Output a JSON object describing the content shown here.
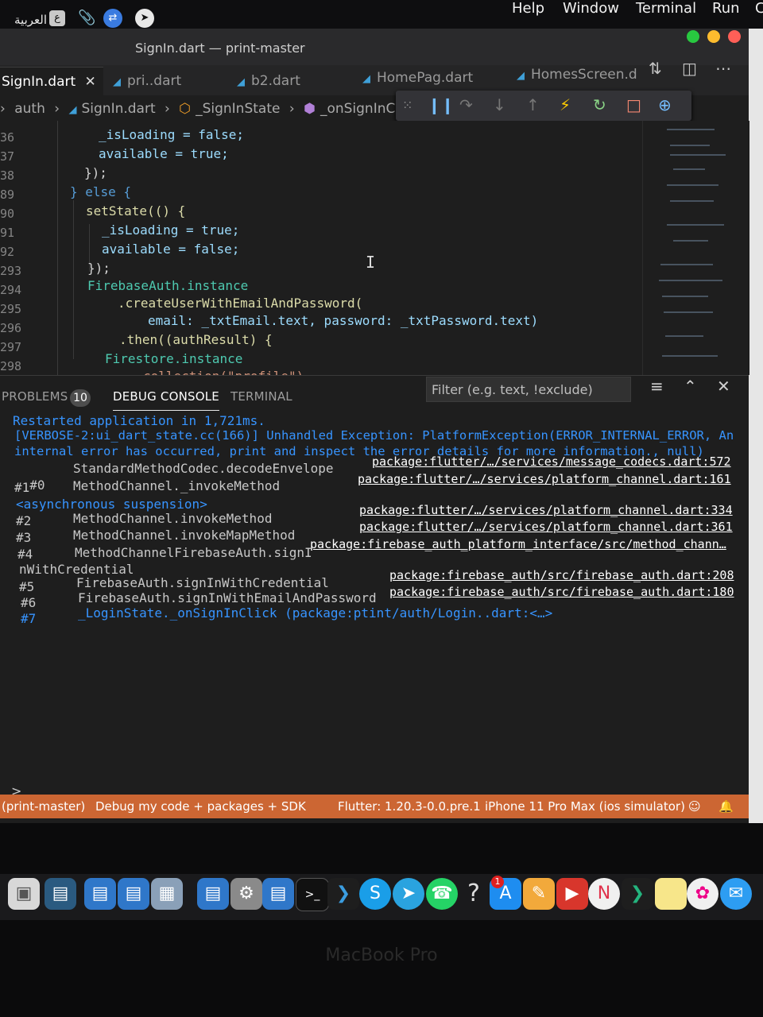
{
  "menubar": {
    "status_text": "العربية",
    "input_char": "ع",
    "items": [
      "Help",
      "Window",
      "Terminal",
      "Run",
      "C"
    ]
  },
  "window": {
    "title": "SignIn.dart — print-master",
    "tabs": [
      {
        "label": "SignIn.dart",
        "active": true
      },
      {
        "label": "pri..dart"
      },
      {
        "label": "b2.dart"
      },
      {
        "label": "HomePag.dart"
      },
      {
        "label": "HomesScreen.d"
      }
    ],
    "breadcrumb": [
      "auth",
      "SignIn.dart",
      "_SignInState",
      "_onSignInClic"
    ]
  },
  "editor": {
    "line_numbers": [
      "36",
      "37",
      "38",
      "89",
      "90",
      "91",
      "92",
      "293",
      "294",
      "295",
      "296",
      "297",
      "298"
    ],
    "lines": [
      "_isLoading = false;",
      "available = true;",
      "});",
      "} else {",
      "setState(() {",
      "_isLoading = true;",
      "available = false;",
      "});",
      "FirebaseAuth.instance",
      ".createUserWithEmailAndPassword(",
      "email: _txtEmail.text, password: _txtPassword.text)",
      ".then((authResult) {",
      "Firestore.instance",
      "collection(\"profile\")"
    ]
  },
  "panel": {
    "tabs": [
      "PROBLEMS",
      "DEBUG CONSOLE",
      "TERMINAL"
    ],
    "problems_count": "10",
    "filter_placeholder": "Filter (e.g. text, !exclude)",
    "console": {
      "line1": "Restarted application in 1,721ms.",
      "line2": "[VERBOSE-2:ui_dart_state.cc(166)] Unhandled Exception: PlatformException(ERROR_INTERNAL_ERROR, An",
      "line3": "internal error has occurred, print and inspect the error details for more information., null)",
      "frames": [
        {
          "num": "#0",
          "name": "StandardMethodCodec.decodeEnvelope",
          "link": "package:flutter/…/services/message_codecs.dart:572"
        },
        {
          "num": "#1",
          "name": "MethodChannel._invokeMethod",
          "link": "package:flutter/…/services/platform_channel.dart:161"
        },
        {
          "num": "#2",
          "name": "MethodChannel.invokeMethod",
          "link": "package:flutter/…/services/platform_channel.dart:334"
        },
        {
          "num": "#3",
          "name": "MethodChannel.invokeMapMethod",
          "link": "package:flutter/…/services/platform_channel.dart:361"
        },
        {
          "num": "#4",
          "name": "MethodChannelFirebaseAuth.signI",
          "link": "package:firebase_auth_platform_interface/src/method_chann…"
        },
        {
          "num": "#5",
          "name": "FirebaseAuth.signInWithCredential",
          "link": "package:firebase_auth/src/firebase_auth.dart:208"
        },
        {
          "num": "#6",
          "name": "FirebaseAuth.signInWithEmailAndPassword",
          "link": "package:firebase_auth/src/firebase_auth.dart:180"
        },
        {
          "num": "#7",
          "name": "_LoginState._onSignInClick (package:ptint/auth/Login..dart:<…>",
          "link": ""
        }
      ],
      "async_suspension": "<asynchronous suspension>",
      "wrap4": "nWithCredential"
    },
    "prompt": ">"
  },
  "statusbar": {
    "branch": "(print-master)",
    "debug_mode": "Debug my code + packages + SDK",
    "flutter": "Flutter: 1.20.3-0.0.pre.1",
    "device": "iPhone 11 Pro Max (ios simulator)"
  },
  "dock": {
    "icons": [
      "finder-icon",
      "folder-icon",
      "folder-icon",
      "folder-icon",
      "preview-icon",
      "folder-icon",
      "settings-icon",
      "folder-icon",
      "terminal-icon",
      "vscode-icon",
      "skype-icon",
      "telegram-icon",
      "whatsapp-icon",
      "help-icon",
      "appstore-icon",
      "pages-icon",
      "pdf-icon",
      "news-icon",
      "vscode-insiders-icon",
      "notes-icon",
      "photos-icon",
      "messages-icon"
    ],
    "appstore_badge": "1"
  },
  "brand": "MacBook Pro",
  "colors": {
    "statusbar": "#cc6633",
    "console_blue": "#3794ff",
    "editor_bg": "#1e1e1e"
  }
}
